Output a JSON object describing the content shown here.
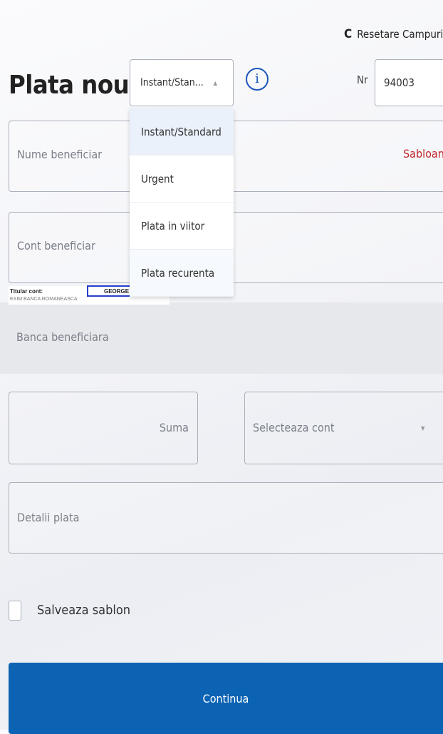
{
  "header": {
    "reset_label": "Resetare Campuri",
    "reset_icon": "refresh-icon",
    "title": "Plata noua",
    "payment_type_selected": "Instant/Stan...",
    "info_glyph": "i",
    "nr_label": "Nr",
    "nr_value": "94003"
  },
  "payment_type_options": [
    {
      "label": "Instant/Standard"
    },
    {
      "label": "Urgent"
    },
    {
      "label": "Plata in viitor"
    },
    {
      "label": "Plata recurenta"
    }
  ],
  "form": {
    "beneficiary_name_placeholder": "Nume beneficiar",
    "templates_link": "Sabloane",
    "beneficiary_account_placeholder": "Cont beneficiar",
    "account_holder_label": "Titular cont:",
    "account_holder_name": "GEORGE B.",
    "account_holder_bank": "EXIM BANCA ROMANEASCA",
    "beneficiary_bank_placeholder": "Banca beneficiara",
    "amount_placeholder": "Suma",
    "account_select_placeholder": "Selecteaza cont",
    "details_placeholder": "Detalii plata",
    "save_template_label": "Salveaza sablon",
    "continue_label": "Continua"
  },
  "colors": {
    "accent_blue": "#0c63b3",
    "templates_red": "#c0282e",
    "info_blue": "#1c56b8"
  }
}
